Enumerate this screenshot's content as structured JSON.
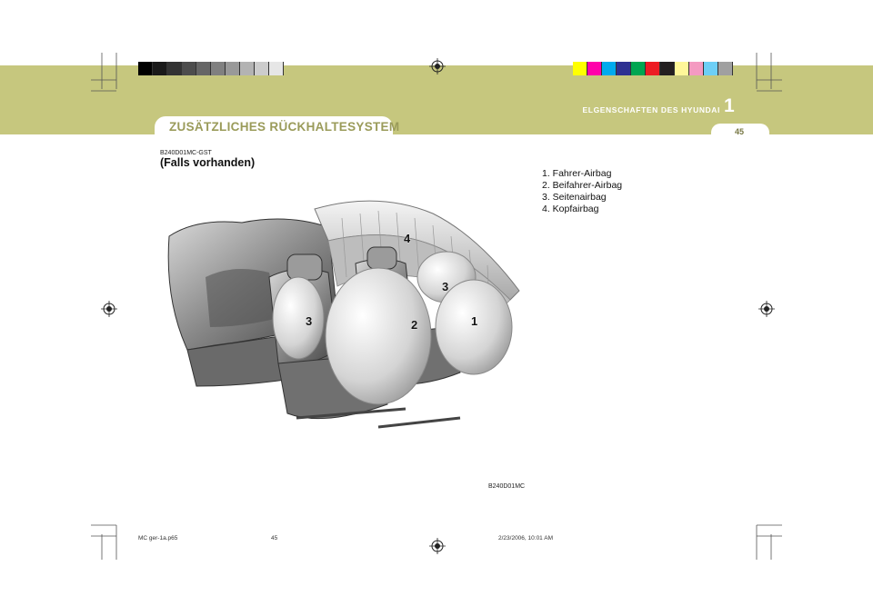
{
  "header": {
    "section_title": "ZUSÄTZLICHES RÜCKHALTESYSTEM",
    "chapter_title": "ELGENSCHAFTEN DES HYUNDAI",
    "chapter_number": "1",
    "page_number": "45"
  },
  "content": {
    "code": "B240D01MC-GST",
    "subtitle": "(Falls vorhanden)",
    "legend": [
      "1. Fahrer-Airbag",
      "2. Beifahrer-Airbag",
      "3. Seitenairbag",
      "4. Kopfairbag"
    ],
    "callouts": [
      "4",
      "3",
      "3",
      "2",
      "1"
    ],
    "image_code": "B240D01MC"
  },
  "footer": {
    "file": "MC ger-1a.p65",
    "page": "45",
    "timestamp": "2/23/2006, 10:01 AM"
  },
  "colors": {
    "band": "#c6c77e",
    "grayscale_bar": [
      "#000000",
      "#1a1a1a",
      "#333333",
      "#4d4d4d",
      "#666666",
      "#808080",
      "#999999",
      "#b3b3b3",
      "#cccccc",
      "#e6e6e6"
    ],
    "color_bar": [
      "#ffff00",
      "#ff00aa",
      "#00aaee",
      "#2e3192",
      "#00a651",
      "#ed1c24",
      "#231f20",
      "#fff799",
      "#f49ac1",
      "#6dcff6",
      "#a0a0a0"
    ]
  }
}
